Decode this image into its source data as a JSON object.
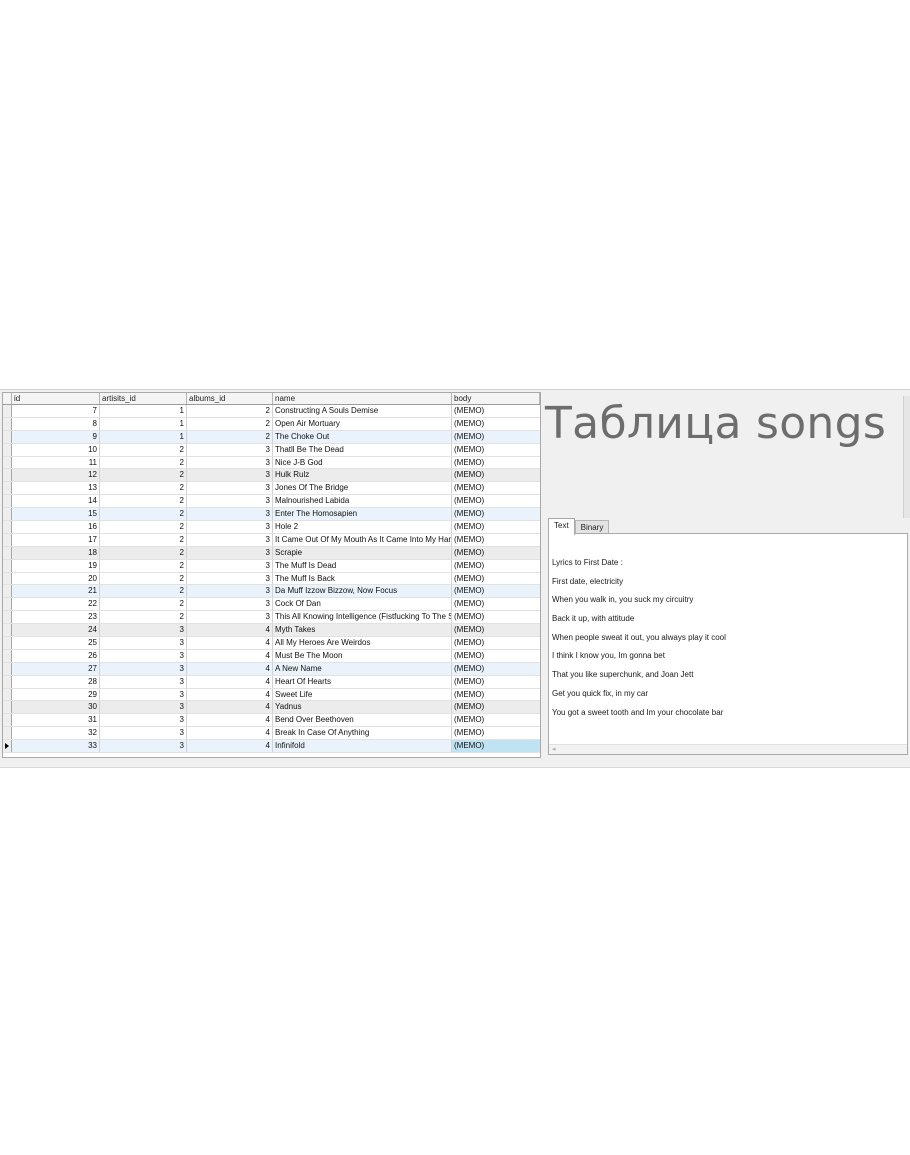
{
  "window": {
    "title": "Таблица songs"
  },
  "grid": {
    "columns": [
      "id",
      "artisits_id",
      "albums_id",
      "name",
      "body"
    ],
    "rows": [
      {
        "id": "7",
        "artisits_id": "1",
        "albums_id": "2",
        "name": "Constructing A Souls Demise",
        "body": "(MEMO)"
      },
      {
        "id": "8",
        "artisits_id": "1",
        "albums_id": "2",
        "name": "Open Air Mortuary",
        "body": "(MEMO)"
      },
      {
        "id": "9",
        "artisits_id": "1",
        "albums_id": "2",
        "name": "The Choke Out",
        "body": "(MEMO)"
      },
      {
        "id": "10",
        "artisits_id": "2",
        "albums_id": "3",
        "name": "Thatll Be The Dead",
        "body": "(MEMO)"
      },
      {
        "id": "11",
        "artisits_id": "2",
        "albums_id": "3",
        "name": "Nice J-B God",
        "body": "(MEMO)"
      },
      {
        "id": "12",
        "artisits_id": "2",
        "albums_id": "3",
        "name": "Hulk Rulz",
        "body": "(MEMO)"
      },
      {
        "id": "13",
        "artisits_id": "2",
        "albums_id": "3",
        "name": "Jones Of The Bridge",
        "body": "(MEMO)"
      },
      {
        "id": "14",
        "artisits_id": "2",
        "albums_id": "3",
        "name": "Malnourished Labida",
        "body": "(MEMO)"
      },
      {
        "id": "15",
        "artisits_id": "2",
        "albums_id": "3",
        "name": "Enter The Homosapien",
        "body": "(MEMO)"
      },
      {
        "id": "16",
        "artisits_id": "2",
        "albums_id": "3",
        "name": "Hole 2",
        "body": "(MEMO)"
      },
      {
        "id": "17",
        "artisits_id": "2",
        "albums_id": "3",
        "name": "It Came Out Of My Mouth As It Came Into My Hand",
        "body": "(MEMO)"
      },
      {
        "id": "18",
        "artisits_id": "2",
        "albums_id": "3",
        "name": "Scrapie",
        "body": "(MEMO)"
      },
      {
        "id": "19",
        "artisits_id": "2",
        "albums_id": "3",
        "name": "The Muff Is Dead",
        "body": "(MEMO)"
      },
      {
        "id": "20",
        "artisits_id": "2",
        "albums_id": "3",
        "name": "The Muff Is Back",
        "body": "(MEMO)"
      },
      {
        "id": "21",
        "artisits_id": "2",
        "albums_id": "3",
        "name": "Da Muff Izzow Bizzow, Now Focus",
        "body": "(MEMO)"
      },
      {
        "id": "22",
        "artisits_id": "2",
        "albums_id": "3",
        "name": "Cock Of Dan",
        "body": "(MEMO)"
      },
      {
        "id": "23",
        "artisits_id": "2",
        "albums_id": "3",
        "name": "This All Knowing Intelligence (Fistfucking To The Sex",
        "body": "(MEMO)"
      },
      {
        "id": "24",
        "artisits_id": "3",
        "albums_id": "4",
        "name": "Myth Takes",
        "body": "(MEMO)"
      },
      {
        "id": "25",
        "artisits_id": "3",
        "albums_id": "4",
        "name": "All My Heroes Are Weirdos",
        "body": "(MEMO)"
      },
      {
        "id": "26",
        "artisits_id": "3",
        "albums_id": "4",
        "name": "Must Be The Moon",
        "body": "(MEMO)"
      },
      {
        "id": "27",
        "artisits_id": "3",
        "albums_id": "4",
        "name": "A New Name",
        "body": "(MEMO)"
      },
      {
        "id": "28",
        "artisits_id": "3",
        "albums_id": "4",
        "name": "Heart Of Hearts",
        "body": "(MEMO)"
      },
      {
        "id": "29",
        "artisits_id": "3",
        "albums_id": "4",
        "name": "Sweet Life",
        "body": "(MEMO)"
      },
      {
        "id": "30",
        "artisits_id": "3",
        "albums_id": "4",
        "name": "Yadnus",
        "body": "(MEMO)"
      },
      {
        "id": "31",
        "artisits_id": "3",
        "albums_id": "4",
        "name": "Bend Over Beethoven",
        "body": "(MEMO)"
      },
      {
        "id": "32",
        "artisits_id": "3",
        "albums_id": "4",
        "name": "Break In Case Of Anything",
        "body": "(MEMO)"
      },
      {
        "id": "33",
        "artisits_id": "3",
        "albums_id": "4",
        "name": "Infinifold",
        "body": "(MEMO)"
      }
    ],
    "selected_row_id": "33"
  },
  "tabs": [
    {
      "label": "Text",
      "active": true
    },
    {
      "label": "Binary",
      "active": false
    }
  ],
  "memo": {
    "lines": [
      "Lyrics to First Date :",
      "First date, electricity",
      "When you walk in, you suck my circuitry",
      "Back it up, with attitude",
      "When people sweat it out, you always play it cool",
      "I think I know you, Im gonna bet",
      "That you like superchunk, and Joan Jett",
      "Get you quick fix, in my car",
      "You got a sweet tooth and Im your chocolate bar"
    ]
  },
  "colors": {
    "row_alt": "#eaf3fb",
    "row_gray": "#ececec",
    "selected_cell": "#bfe3f2",
    "title_text": "#6d6d6d"
  }
}
